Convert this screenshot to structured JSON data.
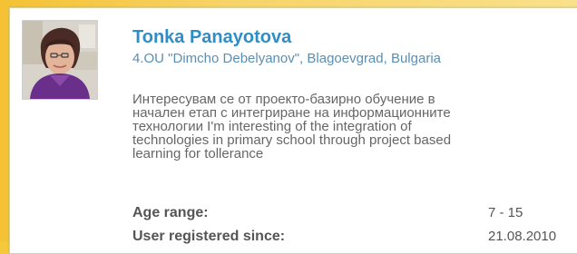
{
  "profile": {
    "name": "Tonka Panayotova",
    "school": "4.OU \"Dimcho Debelyanov\", Blagoevgrad, Bulgaria",
    "bio_lines": [
      "Интересувам се от проекто-базирно обучение в",
      "начален етап с интегриране на информационните",
      "технологии I'm interesting of the integration of",
      "technologies in primary school through project based",
      "learning for tollerance"
    ],
    "age_range_label": "Age range:",
    "age_range_value": "7 - 15",
    "registered_label": "User registered since:",
    "registered_value": "21.08.2010"
  },
  "colors": {
    "name": "#2e8ec8",
    "school": "#5a8fb4",
    "background": "#f5c93a"
  },
  "icons": {
    "avatar": "user-photo"
  }
}
